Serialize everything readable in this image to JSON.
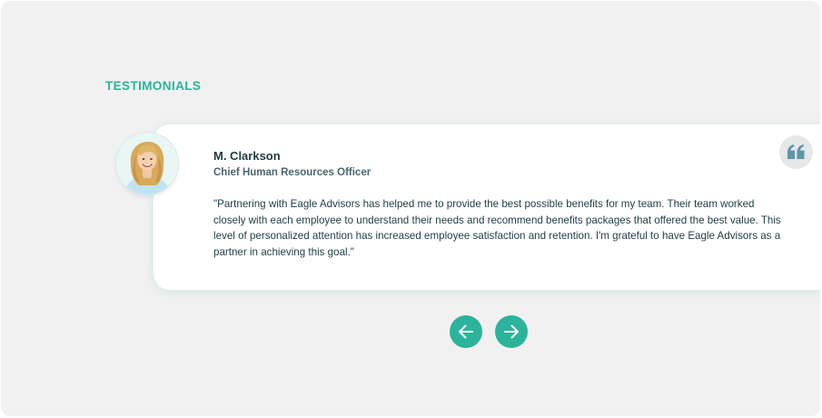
{
  "section": {
    "heading": "TESTIMONIALS"
  },
  "testimonial": {
    "name": "M. Clarkson",
    "role": "Chief Human Resources Officer",
    "quote": "\"Partnering with Eagle Advisors has helped me to provide the best possible benefits for my team. Their team worked closely with each employee to understand their needs and recommend benefits packages that offered the best value. This level of personalized attention has increased employee satisfaction and retention. I'm grateful to have Eagle Advisors as a partner in achieving this goal.\"",
    "avatar_icon": "portrait-photo",
    "quote_icon": "quote-icon"
  },
  "carousel": {
    "prev_icon": "arrow-left-icon",
    "next_icon": "arrow-right-icon"
  },
  "colors": {
    "accent": "#2bb39b",
    "background": "#f1f1f1",
    "card": "#ffffff",
    "text": "#23404a"
  }
}
